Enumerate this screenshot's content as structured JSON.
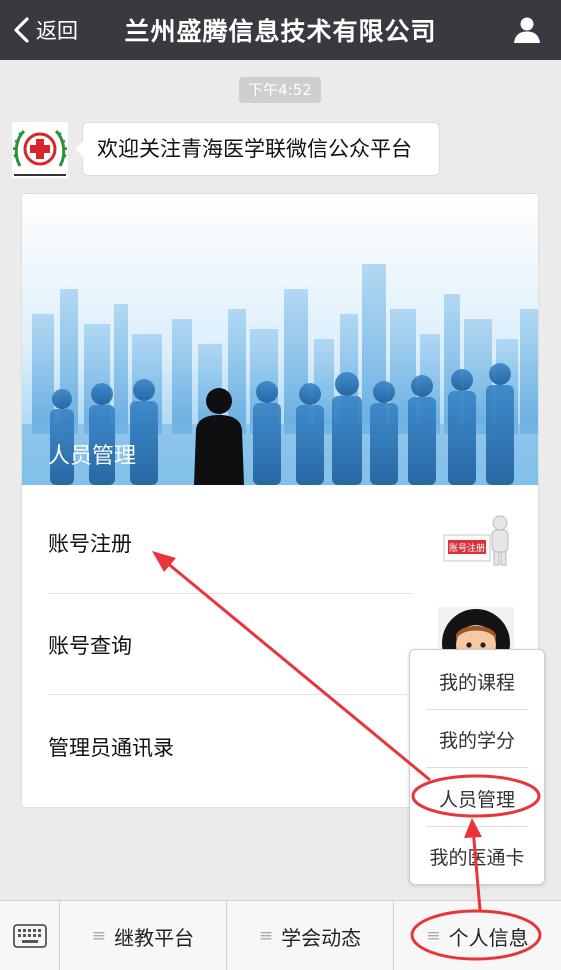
{
  "header": {
    "back_label": "返回",
    "title": "兰州盛腾信息技术有限公司"
  },
  "chat": {
    "time": "下午4:52",
    "message": "欢迎关注青海医学联微信公众平台"
  },
  "card": {
    "hero_label": "人员管理",
    "items": [
      {
        "label": "账号注册",
        "thumb_text": "账号注册"
      },
      {
        "label": "账号查询"
      },
      {
        "label": "管理员通讯录"
      }
    ]
  },
  "popup": {
    "items": [
      "我的课程",
      "我的学分",
      "人员管理",
      "我的医通卡"
    ]
  },
  "bottombar": {
    "tabs": [
      "继教平台",
      "学会动态",
      "个人信息"
    ],
    "tab_icon": "≡"
  },
  "colors": {
    "header_bg": "#393a3f",
    "annotation_red": "#e8353a",
    "sky_blue": "#6fb7e8"
  },
  "icons": [
    "chevron-left-icon",
    "user-icon",
    "keyboard-icon",
    "menu-icon"
  ]
}
